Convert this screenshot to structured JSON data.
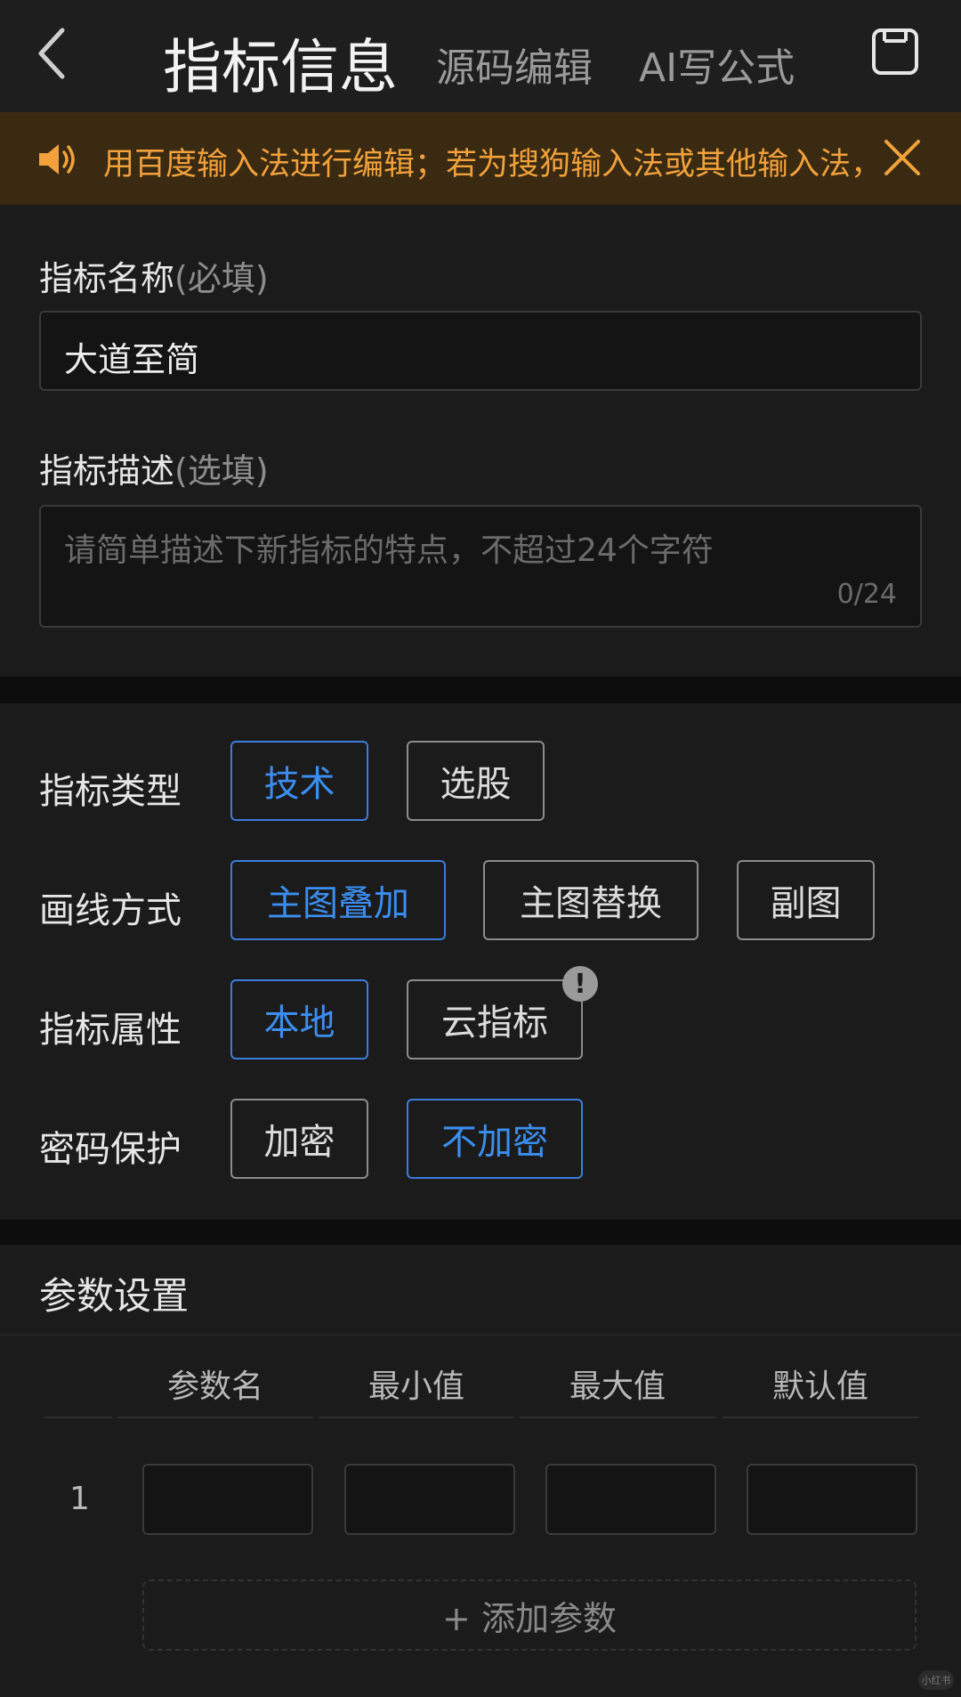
{
  "header": {
    "back_icon": "chevron-left-icon",
    "tabs": [
      {
        "label": "指标信息",
        "active": true
      },
      {
        "label": "源码编辑",
        "active": false
      },
      {
        "label": "AI写公式",
        "active": false
      }
    ],
    "save_icon": "save-icon"
  },
  "notice": {
    "icon": "speaker-icon",
    "text": "用百度输入法进行编辑；若为搜狗输入法或其他输入法，",
    "close_icon": "close-icon",
    "color": "#f2a13b"
  },
  "form": {
    "name": {
      "label": "指标名称",
      "hint": "(必填)",
      "value": "大道至简"
    },
    "description": {
      "label": "指标描述",
      "hint": "(选填)",
      "placeholder": "请简单描述下新指标的特点，不超过24个字符",
      "value": "",
      "counter": "0/24"
    }
  },
  "options": {
    "type": {
      "label": "指标类型",
      "choices": [
        "技术",
        "选股"
      ],
      "selected": "技术"
    },
    "draw_mode": {
      "label": "画线方式",
      "choices": [
        "主图叠加",
        "主图替换",
        "副图"
      ],
      "selected": "主图叠加"
    },
    "attribute": {
      "label": "指标属性",
      "choices": [
        "本地",
        "云指标"
      ],
      "selected": "本地",
      "alert_badge": "!"
    },
    "password": {
      "label": "密码保护",
      "choices": [
        "加密",
        "不加密"
      ],
      "selected": "不加密"
    }
  },
  "params": {
    "title": "参数设置",
    "columns": [
      "参数名",
      "最小值",
      "最大值",
      "默认值"
    ],
    "rows": [
      {
        "index": "1",
        "name": "",
        "min": "",
        "max": "",
        "default": ""
      }
    ],
    "add_label": "+ 添加参数"
  },
  "watermark": "小红书",
  "colors": {
    "accent": "#3b8ef0",
    "background": "#0d0d0d",
    "card": "#1b1b1b"
  }
}
